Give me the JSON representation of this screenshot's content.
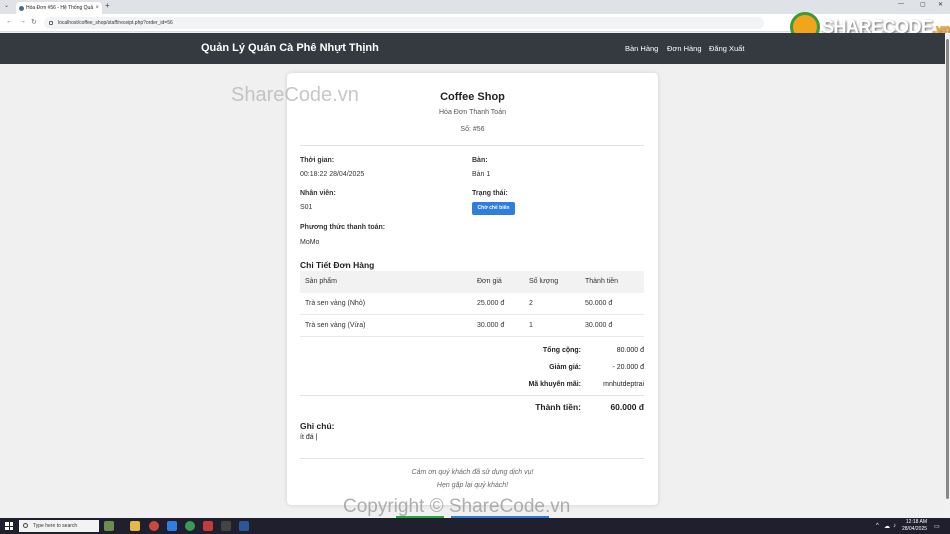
{
  "browser": {
    "tab_title": "Hóa Đơn #56 - Hệ Thống Quả",
    "url": "localhost/coffee_shop/staff/receipt.php?order_id=56"
  },
  "watermark": {
    "logo_text": "SHARECODE",
    "logo_suffix": ".vn",
    "top_text": "ShareCode.vn",
    "bottom_text": "Copyright © ShareCode.vn"
  },
  "navbar": {
    "brand": "Quản Lý Quán Cà Phê Nhựt Thịnh",
    "links": [
      "Bàn Hàng",
      "Đơn Hàng",
      "Đăng Xuất"
    ]
  },
  "receipt": {
    "shop_name": "Coffee Shop",
    "subtitle": "Hóa Đơn Thanh Toán",
    "number": "Số: #56",
    "time_label": "Thời gian:",
    "time_value": "00:18:22 28/04/2025",
    "table_label": "Bàn:",
    "table_value": "Bàn 1",
    "staff_label": "Nhân viên:",
    "staff_value": "S01",
    "status_label": "Trạng thái:",
    "status_value": "Chờ chế biến",
    "payment_label": "Phương thức thanh toán:",
    "payment_value": "MoMo",
    "details_title": "Chi Tiết Đơn Hàng",
    "columns": [
      "Sản phẩm",
      "Đơn giá",
      "Số lượng",
      "Thành tiền"
    ],
    "items": [
      {
        "name": "Trà sen vàng (Nhỏ)",
        "price": "25.000 đ",
        "qty": "2",
        "amount": "50.000 đ"
      },
      {
        "name": "Trà sen vàng (Vừa)",
        "price": "30.000 đ",
        "qty": "1",
        "amount": "30.000 đ"
      }
    ],
    "subtotal_label": "Tổng cộng:",
    "subtotal_value": "80.000 đ",
    "discount_label": "Giảm giá:",
    "discount_value": "- 20.000 đ",
    "promo_label": "Mã khuyến mãi:",
    "promo_value": "mnhutdeptrai",
    "total_label": "Thành tiền:",
    "total_value": "60.000 đ",
    "note_label": "Ghi chú:",
    "note_value": "ít đá |",
    "thanks_line1": "Cảm ơn quý khách đã sử dụng dịch vụ!",
    "thanks_line2": "Hẹn gặp lại quý khách!"
  },
  "taskbar": {
    "search_placeholder": "Type here to search",
    "time": "12:18 AM",
    "date": "28/04/2025"
  },
  "colors": {
    "navbar": "#343a40",
    "status_badge": "#2f7de1",
    "print_button": "#28a745"
  }
}
